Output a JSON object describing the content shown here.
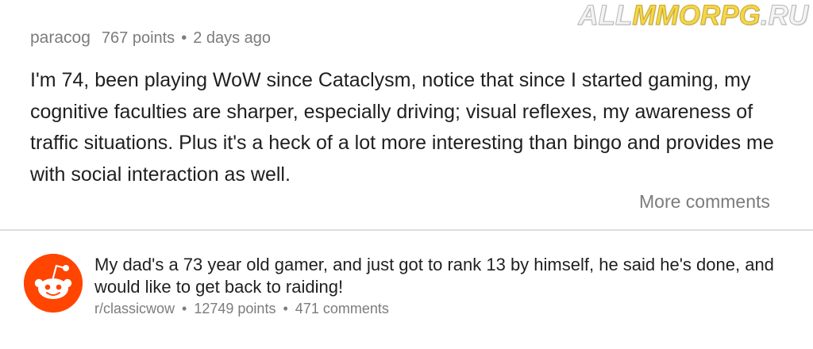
{
  "watermark": {
    "left": "ALL",
    "middle": "MMORPG",
    "right": ".RU"
  },
  "comment": {
    "author": "paracog",
    "points": "767 points",
    "separator": "•",
    "age": "2 days ago",
    "text": "I'm 74, been playing WoW since Cataclysm, notice that since I started gaming, my cognitive faculties are sharper, especially driving; visual reflexes, my awareness of traffic situations. Plus it's a heck of a lot more interesting than bingo and provides me with social interaction as well.",
    "more_comments_label": "More comments"
  },
  "post": {
    "avatar_icon": "reddit-snoo-icon",
    "title": "My dad's a 73 year old gamer, and just got to rank 13 by himself, he said he's done, and would like to get back to raiding!",
    "subreddit": "r/classicwow",
    "separator": "•",
    "points": "12749 points",
    "comments": "471 comments"
  },
  "colors": {
    "reddit_orange": "#ff4500",
    "meta_gray": "#7c7c7c",
    "text": "#1f1f1f",
    "divider": "#dcdcdc"
  }
}
